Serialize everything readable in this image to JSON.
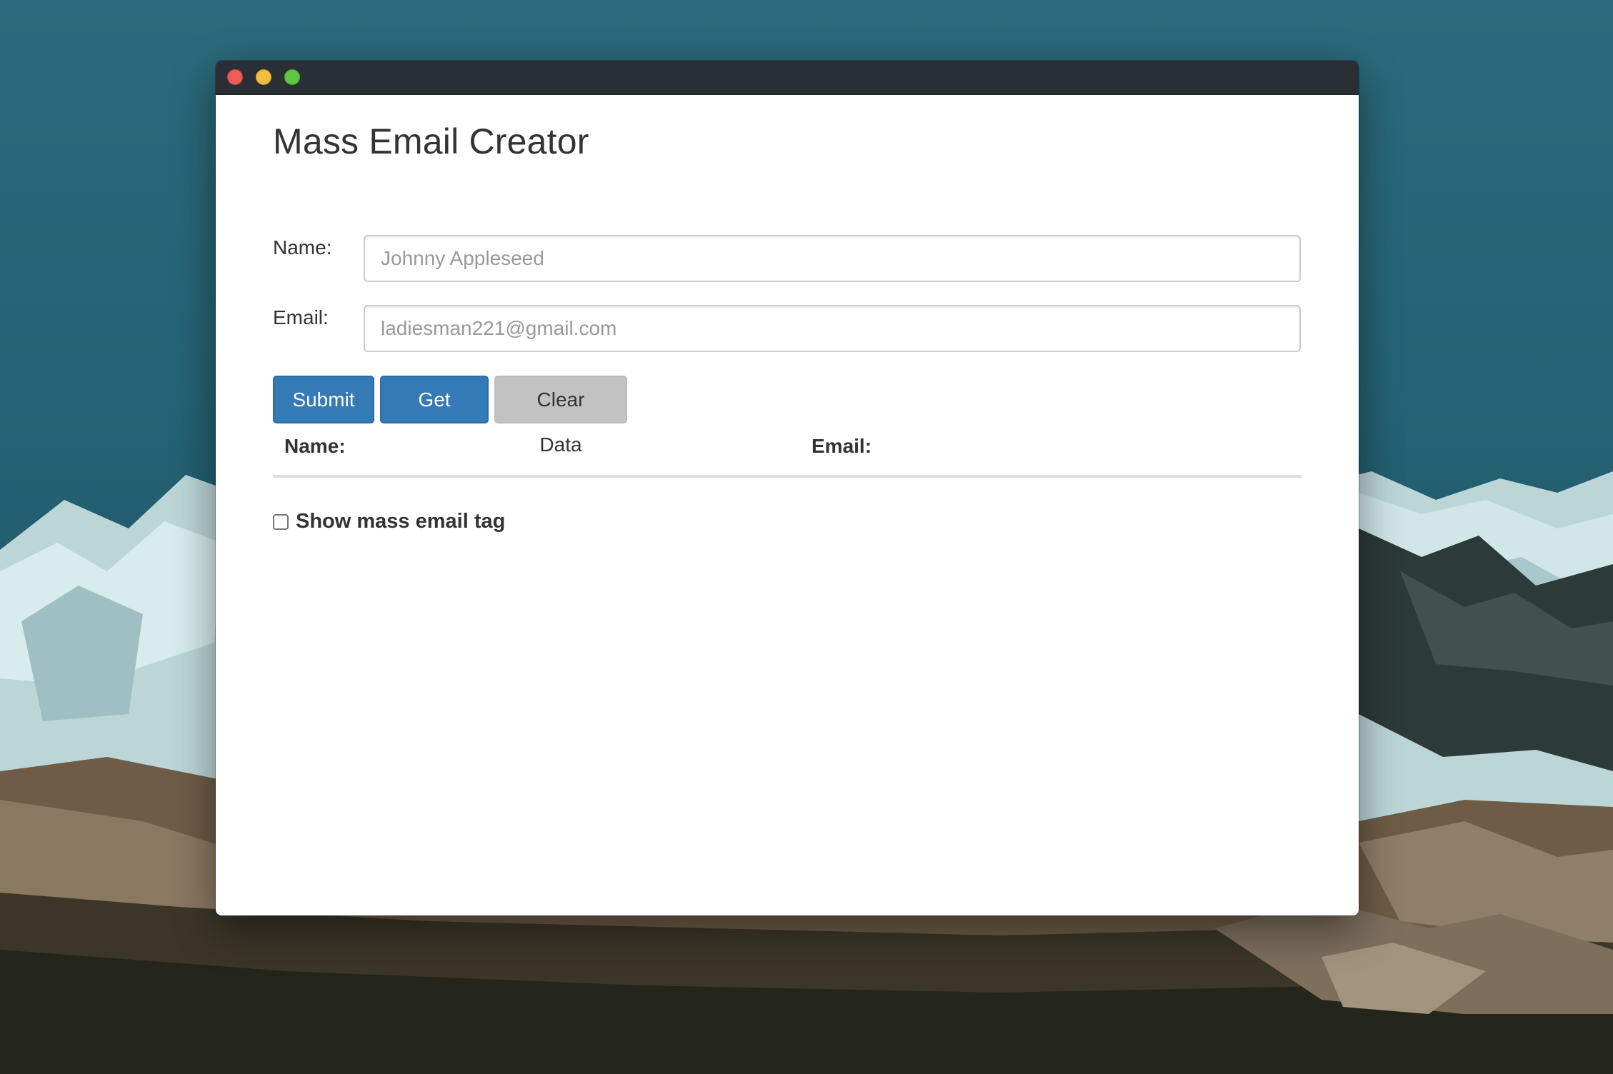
{
  "window": {
    "controls": {
      "close": "close",
      "minimize": "minimize",
      "maximize": "maximize"
    },
    "colors": {
      "titlebar": "#2a2f36",
      "close": "#ee5c55",
      "minimize": "#f3bd3d",
      "maximize": "#5ec741"
    }
  },
  "app": {
    "title": "Mass Email Creator"
  },
  "form": {
    "name_label": "Name:",
    "name_placeholder": "Johnny Appleseed",
    "name_value": "",
    "email_label": "Email:",
    "email_placeholder": "ladiesman221@gmail.com",
    "email_value": ""
  },
  "buttons": {
    "submit": "Submit",
    "get_info": "Get Info",
    "clear_data": "Clear Data",
    "primary_color": "#337ab7",
    "default_color": "#c2c2c2"
  },
  "table": {
    "headers": [
      "Name:",
      "Email:"
    ],
    "rows": []
  },
  "options": {
    "show_tag_label": "Show mass email tag",
    "show_tag_checked": false
  }
}
